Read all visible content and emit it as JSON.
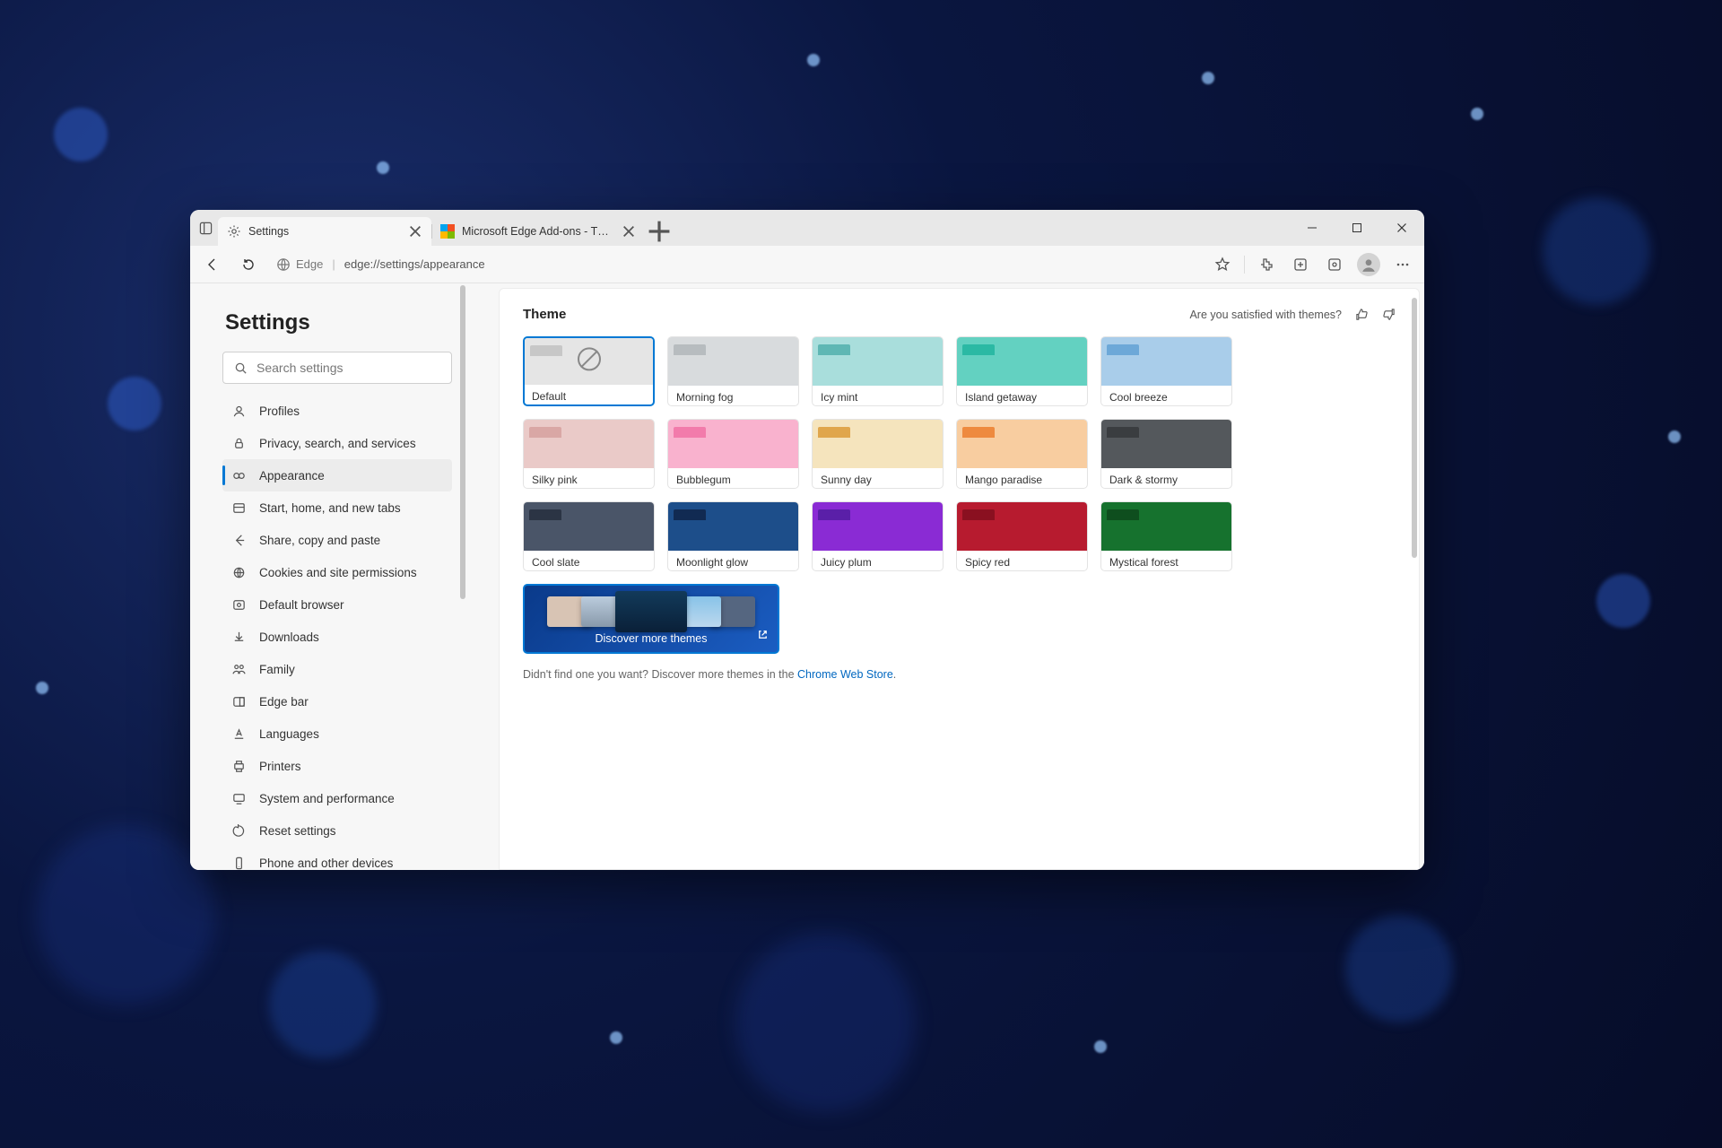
{
  "tabs": [
    {
      "title": "Settings"
    },
    {
      "title": "Microsoft Edge Add-ons - Them…"
    }
  ],
  "address": {
    "scheme": "Edge",
    "url": "edge://settings/appearance"
  },
  "sidebar": {
    "heading": "Settings",
    "search_placeholder": "Search settings",
    "items": [
      {
        "label": "Profiles"
      },
      {
        "label": "Privacy, search, and services"
      },
      {
        "label": "Appearance"
      },
      {
        "label": "Start, home, and new tabs"
      },
      {
        "label": "Share, copy and paste"
      },
      {
        "label": "Cookies and site permissions"
      },
      {
        "label": "Default browser"
      },
      {
        "label": "Downloads"
      },
      {
        "label": "Family"
      },
      {
        "label": "Edge bar"
      },
      {
        "label": "Languages"
      },
      {
        "label": "Printers"
      },
      {
        "label": "System and performance"
      },
      {
        "label": "Reset settings"
      },
      {
        "label": "Phone and other devices"
      }
    ]
  },
  "main": {
    "heading": "Theme",
    "feedback_prompt": "Are you satisfied with themes?",
    "themes": [
      {
        "label": "Default",
        "sel": true,
        "tab": "#cfcfcf",
        "body": "#dcdcdc",
        "default": true
      },
      {
        "label": "Morning fog",
        "tab": "#b7bcbf",
        "body": "#d8dbdd"
      },
      {
        "label": "Icy mint",
        "tab": "#5fb7b4",
        "body": "#a9dedc"
      },
      {
        "label": "Island getaway",
        "tab": "#2bb9a4",
        "body": "#63d1c1"
      },
      {
        "label": "Cool breeze",
        "tab": "#6da8d8",
        "body": "#a9cdea"
      },
      {
        "label": "Silky pink",
        "tab": "#d9a7a5",
        "body": "#eacac8"
      },
      {
        "label": "Bubblegum",
        "tab": "#f27bab",
        "body": "#f9b2ce"
      },
      {
        "label": "Sunny day",
        "tab": "#e0a64c",
        "body": "#f5e4bd"
      },
      {
        "label": "Mango paradise",
        "tab": "#ee8a3f",
        "body": "#f8cda0"
      },
      {
        "label": "Dark & stormy",
        "tab": "#3a3d40",
        "body": "#54585c"
      },
      {
        "label": "Cool slate",
        "tab": "#2b3444",
        "body": "#4a5568"
      },
      {
        "label": "Moonlight glow",
        "tab": "#112a52",
        "body": "#1d4e8a"
      },
      {
        "label": "Juicy plum",
        "tab": "#5a1fa8",
        "body": "#8a2bd4"
      },
      {
        "label": "Spicy red",
        "tab": "#8a1020",
        "body": "#b71b2f"
      },
      {
        "label": "Mystical forest",
        "tab": "#0e4e1e",
        "body": "#16722e"
      }
    ],
    "discover_label": "Discover more themes",
    "footer_pre": "Didn't find one you want? Discover more themes in the ",
    "footer_link": "Chrome Web Store",
    "footer_post": "."
  }
}
